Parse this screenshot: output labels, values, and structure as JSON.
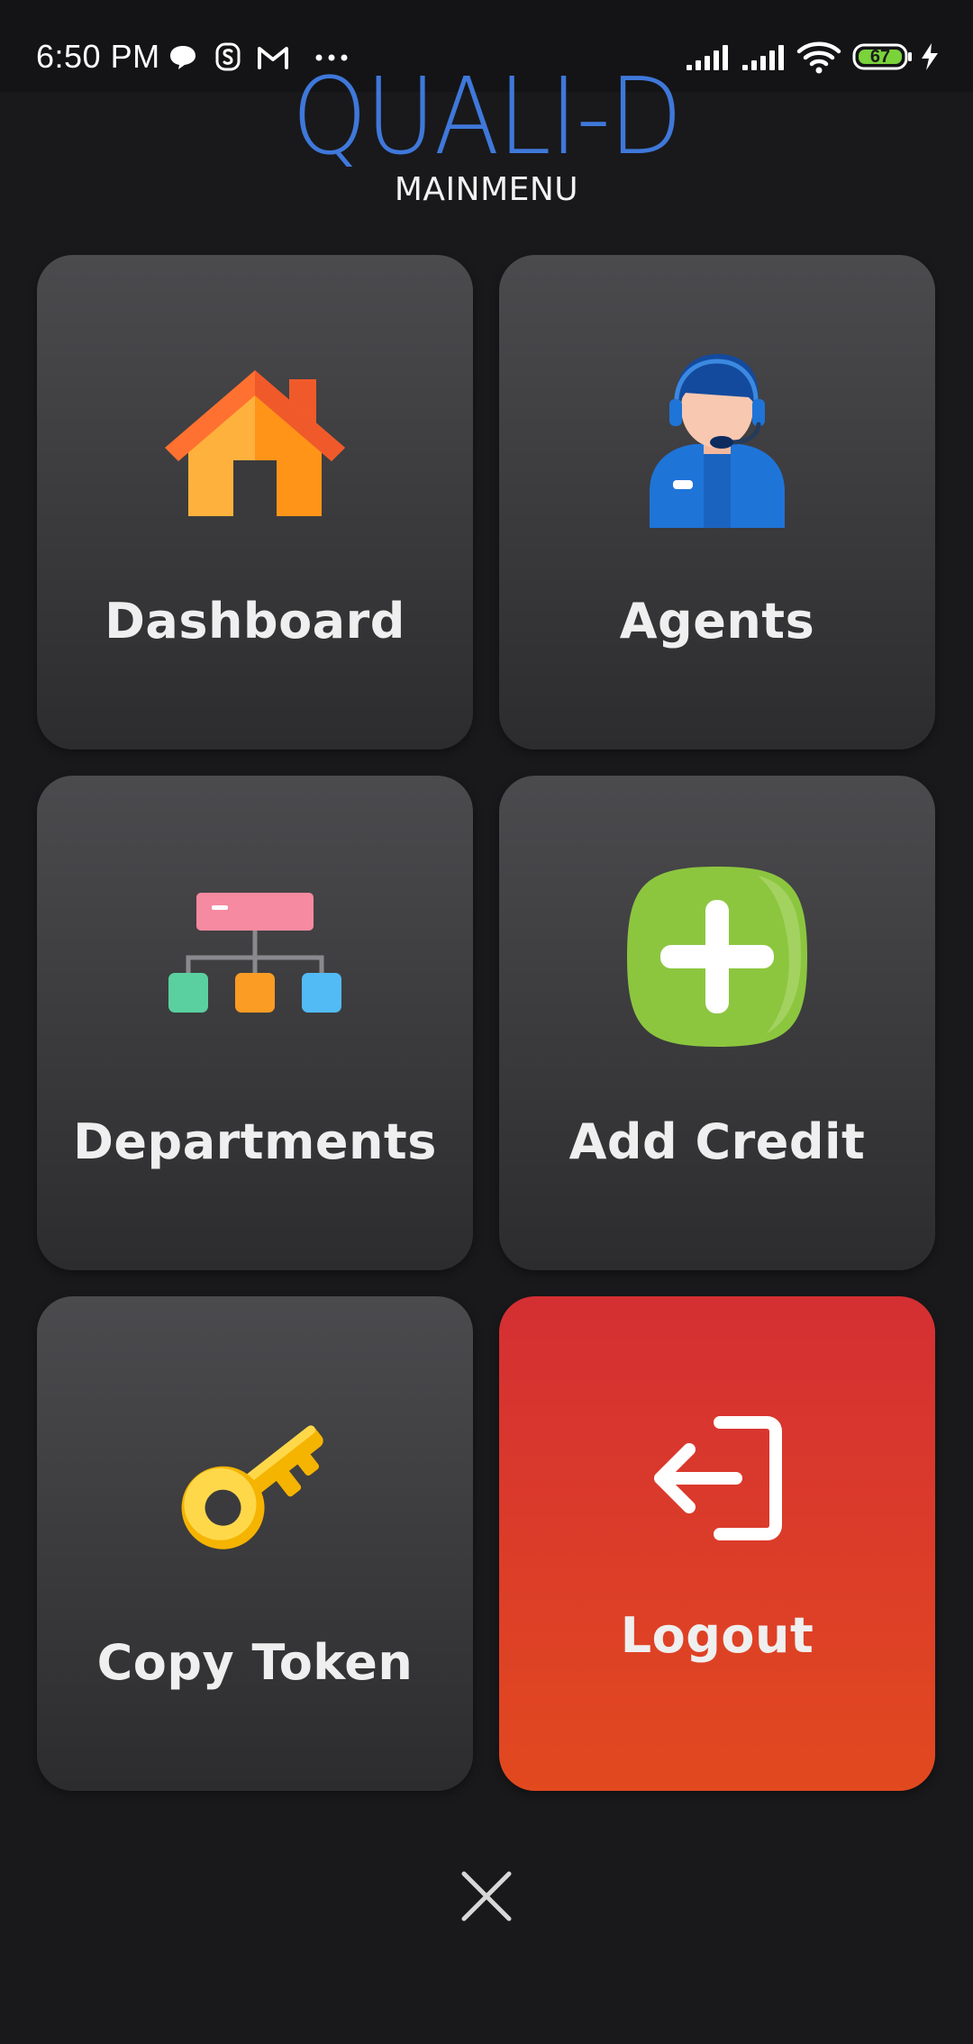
{
  "status_bar": {
    "time": "6:50 PM",
    "battery_level": "67",
    "left_icons": [
      "chat-bubble-icon",
      "s-app-icon",
      "gmail-icon",
      "more-dots-icon"
    ],
    "right_icons": [
      "signal-icon",
      "signal-icon",
      "wifi-icon",
      "battery-icon",
      "charging-icon"
    ]
  },
  "header": {
    "app_logo": "QUALI-D",
    "subtitle": "MAINMENU"
  },
  "menu": {
    "items": [
      {
        "label": "Dashboard",
        "icon": "house-icon"
      },
      {
        "label": "Agents",
        "icon": "support-agent-icon"
      },
      {
        "label": "Departments",
        "icon": "org-chart-icon"
      },
      {
        "label": "Add Credit",
        "icon": "plus-icon"
      },
      {
        "label": "Copy Token",
        "icon": "key-icon"
      },
      {
        "label": "Logout",
        "icon": "logout-arrow-icon"
      }
    ]
  },
  "footer": {
    "close_icon": "close-icon"
  },
  "colors": {
    "background": "#19191b",
    "status_bar": "#141416",
    "logo_blue": "#3f78da",
    "tile_top": "#4b4a4d",
    "tile_bottom": "#2c2c2e",
    "logout_top": "#d42f33",
    "logout_bottom": "#e2491f",
    "battery_green": "#7ad33a"
  }
}
